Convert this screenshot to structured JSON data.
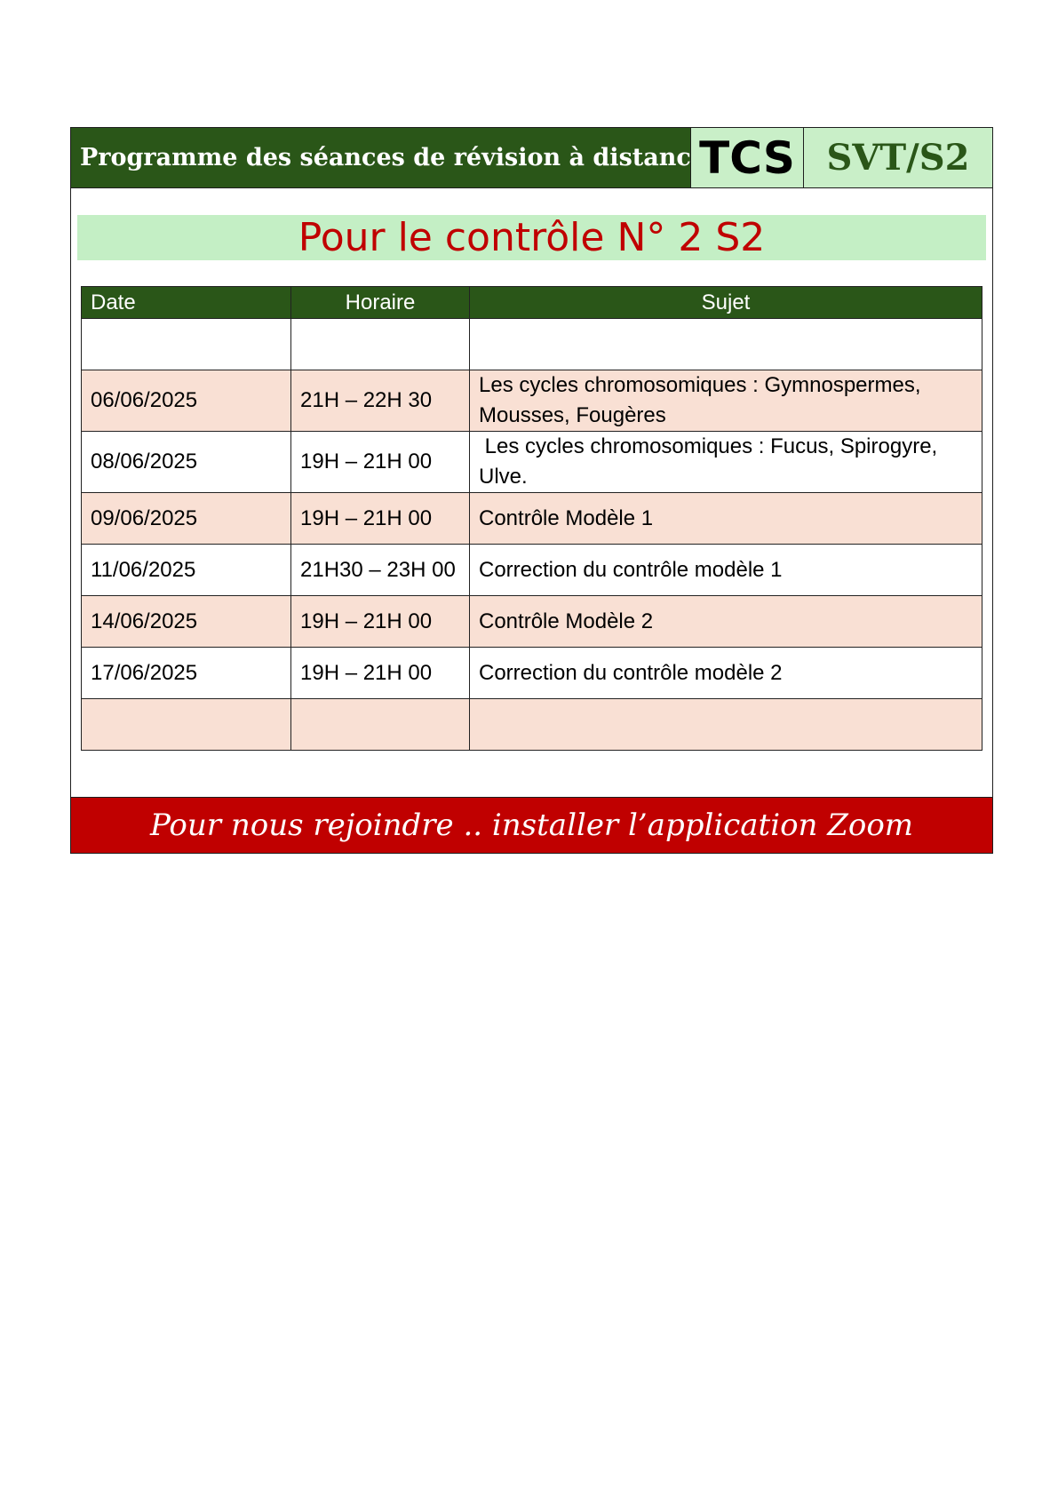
{
  "header": {
    "title": "Programme des séances de révision à distance",
    "level": "TCS",
    "subject": "SVT/S2"
  },
  "banner": {
    "text": "Pour le contrôle N° 2 S2"
  },
  "table": {
    "columns": [
      "Date",
      "Horaire",
      "Sujet"
    ],
    "rows": [
      {
        "date": "",
        "time": "",
        "subject": "",
        "shaded": false
      },
      {
        "date": "06/06/2025",
        "time": "21H – 22H 30",
        "subject": "Les cycles chromosomiques : Gymnospermes, Mousses, Fougères",
        "shaded": true
      },
      {
        "date": "08/06/2025",
        "time": "19H – 21H 00",
        "subject": " Les cycles chromosomiques : Fucus, Spirogyre, Ulve.",
        "shaded": false
      },
      {
        "date": "09/06/2025",
        "time": "19H – 21H 00",
        "subject": "Contrôle Modèle 1",
        "shaded": true
      },
      {
        "date": "11/06/2025",
        "time": "21H30 – 23H 00",
        "subject": "Correction du contrôle modèle 1",
        "shaded": false
      },
      {
        "date": "14/06/2025",
        "time": "19H – 21H 00",
        "subject": "Contrôle Modèle 2",
        "shaded": true
      },
      {
        "date": "17/06/2025",
        "time": "19H – 21H 00",
        "subject": "Correction du contrôle modèle 2",
        "shaded": false
      },
      {
        "date": "",
        "time": "",
        "subject": "",
        "shaded": true
      }
    ]
  },
  "footer": {
    "text": "Pour nous rejoindre .. installer l’application Zoom"
  },
  "colors": {
    "dark_green": "#2a5618",
    "light_green": "#c9efc8",
    "red": "#c00000",
    "shaded_row": "#f9e0d4"
  }
}
